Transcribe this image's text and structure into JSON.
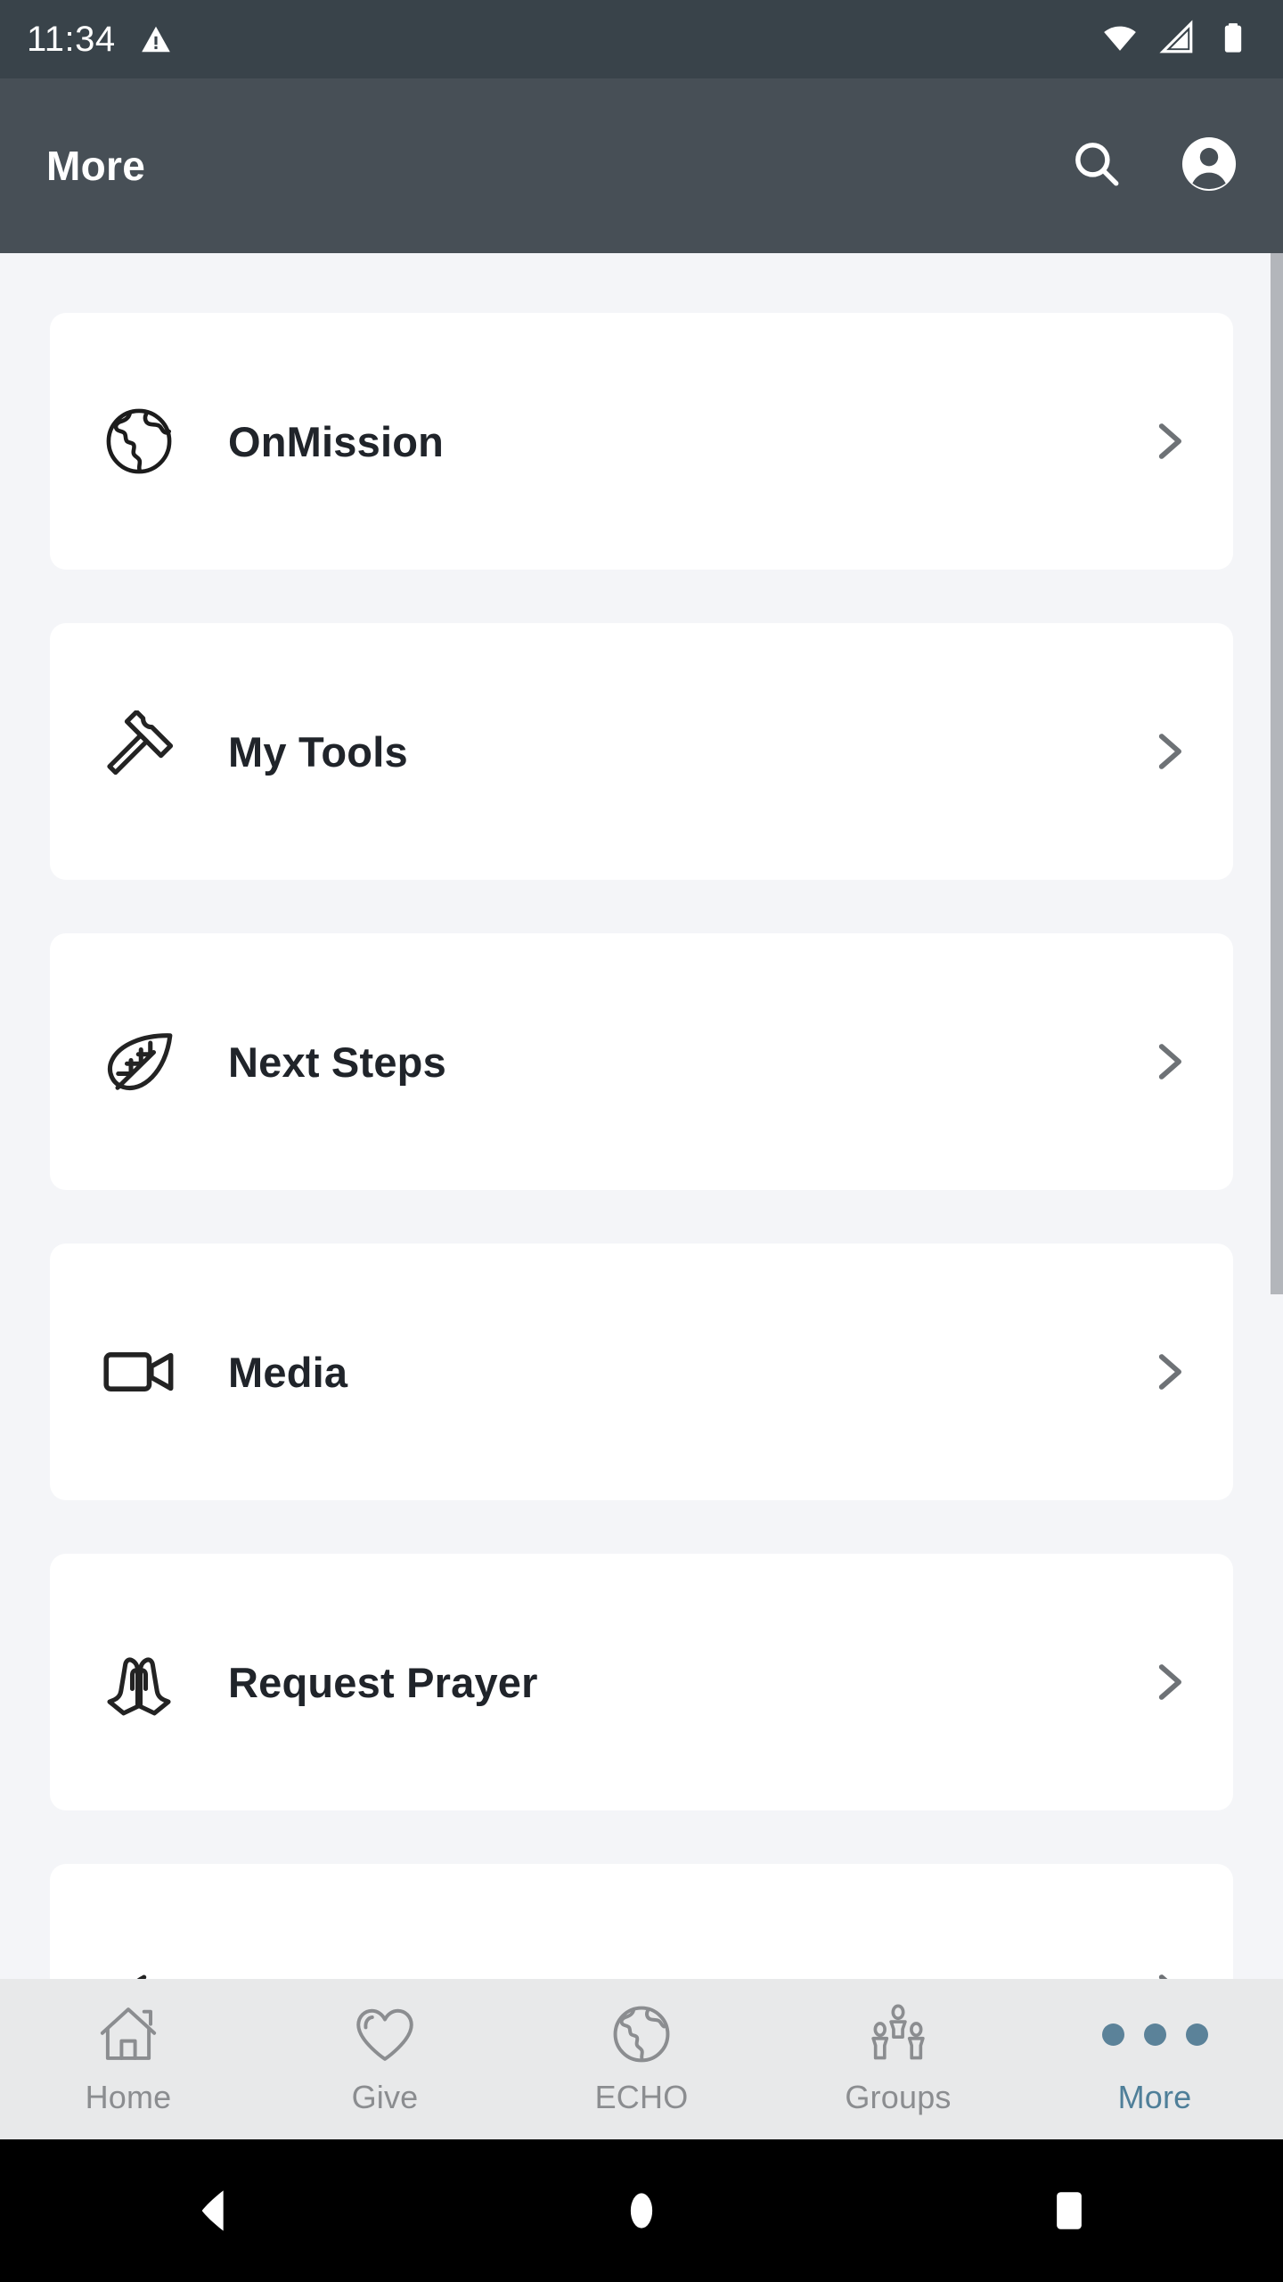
{
  "status_bar": {
    "time": "11:34",
    "warning_icon": "warning-triangle-icon",
    "wifi_icon": "wifi-icon",
    "signal_icon": "cell-signal-icon",
    "battery_icon": "battery-full-icon"
  },
  "app_bar": {
    "title": "More",
    "search_icon": "search-icon",
    "profile_icon": "account-avatar-icon"
  },
  "menu": {
    "items": [
      {
        "label": "OnMission",
        "icon": "globe-icon",
        "chevron": "chevron-right-icon"
      },
      {
        "label": "My Tools",
        "icon": "hammer-icon",
        "chevron": "chevron-right-icon"
      },
      {
        "label": "Next Steps",
        "icon": "leaf-icon",
        "chevron": "chevron-right-icon"
      },
      {
        "label": "Media",
        "icon": "video-camera-icon",
        "chevron": "chevron-right-icon"
      },
      {
        "label": "Request Prayer",
        "icon": "praying-hands-icon",
        "chevron": "chevron-right-icon"
      },
      {
        "label": "",
        "icon": "partial-icon",
        "chevron": "chevron-right-icon"
      }
    ]
  },
  "tab_bar": {
    "active": "More",
    "active_color": "#4f7f99",
    "inactive_color": "#8b8d90",
    "tabs": [
      {
        "label": "Home",
        "icon": "home-icon"
      },
      {
        "label": "Give",
        "icon": "heart-icon"
      },
      {
        "label": "ECHO",
        "icon": "globe-icon"
      },
      {
        "label": "Groups",
        "icon": "people-group-icon"
      },
      {
        "label": "More",
        "icon": "three-dots-icon"
      }
    ]
  },
  "system_nav": {
    "back": "back-triangle-icon",
    "home": "home-circle-icon",
    "recents": "recents-square-icon"
  },
  "theme": {
    "status_bar_bg": "#39434a",
    "app_bar_bg": "#474f56",
    "page_bg": "#f4f5f8",
    "card_bg": "#ffffff",
    "text_dark": "#20242a",
    "chevron_gray": "#6e7276",
    "tab_bar_bg": "#e8e9ea"
  }
}
